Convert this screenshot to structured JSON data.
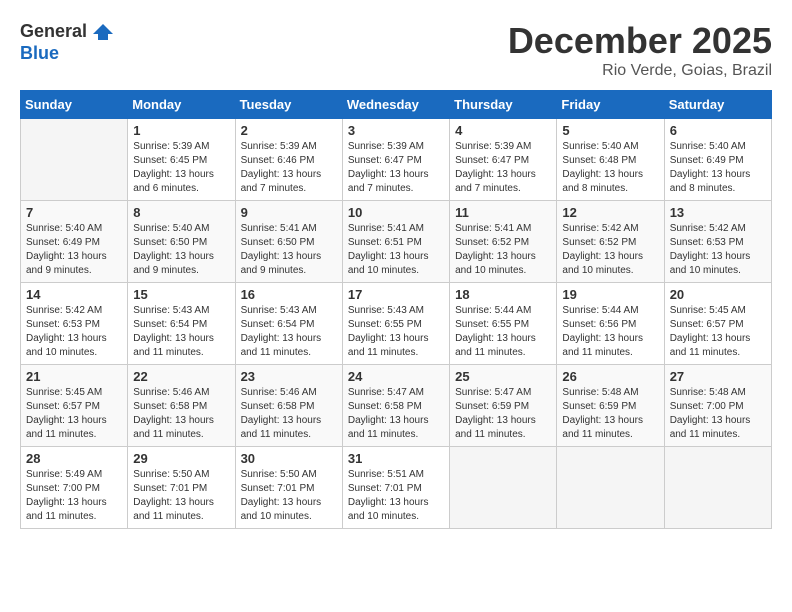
{
  "logo": {
    "general": "General",
    "blue": "Blue"
  },
  "title": "December 2025",
  "location": "Rio Verde, Goias, Brazil",
  "days_of_week": [
    "Sunday",
    "Monday",
    "Tuesday",
    "Wednesday",
    "Thursday",
    "Friday",
    "Saturday"
  ],
  "weeks": [
    [
      {
        "day": "",
        "sunrise": "",
        "sunset": "",
        "daylight": ""
      },
      {
        "day": "1",
        "sunrise": "Sunrise: 5:39 AM",
        "sunset": "Sunset: 6:45 PM",
        "daylight": "Daylight: 13 hours and 6 minutes."
      },
      {
        "day": "2",
        "sunrise": "Sunrise: 5:39 AM",
        "sunset": "Sunset: 6:46 PM",
        "daylight": "Daylight: 13 hours and 7 minutes."
      },
      {
        "day": "3",
        "sunrise": "Sunrise: 5:39 AM",
        "sunset": "Sunset: 6:47 PM",
        "daylight": "Daylight: 13 hours and 7 minutes."
      },
      {
        "day": "4",
        "sunrise": "Sunrise: 5:39 AM",
        "sunset": "Sunset: 6:47 PM",
        "daylight": "Daylight: 13 hours and 7 minutes."
      },
      {
        "day": "5",
        "sunrise": "Sunrise: 5:40 AM",
        "sunset": "Sunset: 6:48 PM",
        "daylight": "Daylight: 13 hours and 8 minutes."
      },
      {
        "day": "6",
        "sunrise": "Sunrise: 5:40 AM",
        "sunset": "Sunset: 6:49 PM",
        "daylight": "Daylight: 13 hours and 8 minutes."
      }
    ],
    [
      {
        "day": "7",
        "sunrise": "Sunrise: 5:40 AM",
        "sunset": "Sunset: 6:49 PM",
        "daylight": "Daylight: 13 hours and 9 minutes."
      },
      {
        "day": "8",
        "sunrise": "Sunrise: 5:40 AM",
        "sunset": "Sunset: 6:50 PM",
        "daylight": "Daylight: 13 hours and 9 minutes."
      },
      {
        "day": "9",
        "sunrise": "Sunrise: 5:41 AM",
        "sunset": "Sunset: 6:50 PM",
        "daylight": "Daylight: 13 hours and 9 minutes."
      },
      {
        "day": "10",
        "sunrise": "Sunrise: 5:41 AM",
        "sunset": "Sunset: 6:51 PM",
        "daylight": "Daylight: 13 hours and 10 minutes."
      },
      {
        "day": "11",
        "sunrise": "Sunrise: 5:41 AM",
        "sunset": "Sunset: 6:52 PM",
        "daylight": "Daylight: 13 hours and 10 minutes."
      },
      {
        "day": "12",
        "sunrise": "Sunrise: 5:42 AM",
        "sunset": "Sunset: 6:52 PM",
        "daylight": "Daylight: 13 hours and 10 minutes."
      },
      {
        "day": "13",
        "sunrise": "Sunrise: 5:42 AM",
        "sunset": "Sunset: 6:53 PM",
        "daylight": "Daylight: 13 hours and 10 minutes."
      }
    ],
    [
      {
        "day": "14",
        "sunrise": "Sunrise: 5:42 AM",
        "sunset": "Sunset: 6:53 PM",
        "daylight": "Daylight: 13 hours and 10 minutes."
      },
      {
        "day": "15",
        "sunrise": "Sunrise: 5:43 AM",
        "sunset": "Sunset: 6:54 PM",
        "daylight": "Daylight: 13 hours and 11 minutes."
      },
      {
        "day": "16",
        "sunrise": "Sunrise: 5:43 AM",
        "sunset": "Sunset: 6:54 PM",
        "daylight": "Daylight: 13 hours and 11 minutes."
      },
      {
        "day": "17",
        "sunrise": "Sunrise: 5:43 AM",
        "sunset": "Sunset: 6:55 PM",
        "daylight": "Daylight: 13 hours and 11 minutes."
      },
      {
        "day": "18",
        "sunrise": "Sunrise: 5:44 AM",
        "sunset": "Sunset: 6:55 PM",
        "daylight": "Daylight: 13 hours and 11 minutes."
      },
      {
        "day": "19",
        "sunrise": "Sunrise: 5:44 AM",
        "sunset": "Sunset: 6:56 PM",
        "daylight": "Daylight: 13 hours and 11 minutes."
      },
      {
        "day": "20",
        "sunrise": "Sunrise: 5:45 AM",
        "sunset": "Sunset: 6:57 PM",
        "daylight": "Daylight: 13 hours and 11 minutes."
      }
    ],
    [
      {
        "day": "21",
        "sunrise": "Sunrise: 5:45 AM",
        "sunset": "Sunset: 6:57 PM",
        "daylight": "Daylight: 13 hours and 11 minutes."
      },
      {
        "day": "22",
        "sunrise": "Sunrise: 5:46 AM",
        "sunset": "Sunset: 6:58 PM",
        "daylight": "Daylight: 13 hours and 11 minutes."
      },
      {
        "day": "23",
        "sunrise": "Sunrise: 5:46 AM",
        "sunset": "Sunset: 6:58 PM",
        "daylight": "Daylight: 13 hours and 11 minutes."
      },
      {
        "day": "24",
        "sunrise": "Sunrise: 5:47 AM",
        "sunset": "Sunset: 6:58 PM",
        "daylight": "Daylight: 13 hours and 11 minutes."
      },
      {
        "day": "25",
        "sunrise": "Sunrise: 5:47 AM",
        "sunset": "Sunset: 6:59 PM",
        "daylight": "Daylight: 13 hours and 11 minutes."
      },
      {
        "day": "26",
        "sunrise": "Sunrise: 5:48 AM",
        "sunset": "Sunset: 6:59 PM",
        "daylight": "Daylight: 13 hours and 11 minutes."
      },
      {
        "day": "27",
        "sunrise": "Sunrise: 5:48 AM",
        "sunset": "Sunset: 7:00 PM",
        "daylight": "Daylight: 13 hours and 11 minutes."
      }
    ],
    [
      {
        "day": "28",
        "sunrise": "Sunrise: 5:49 AM",
        "sunset": "Sunset: 7:00 PM",
        "daylight": "Daylight: 13 hours and 11 minutes."
      },
      {
        "day": "29",
        "sunrise": "Sunrise: 5:50 AM",
        "sunset": "Sunset: 7:01 PM",
        "daylight": "Daylight: 13 hours and 11 minutes."
      },
      {
        "day": "30",
        "sunrise": "Sunrise: 5:50 AM",
        "sunset": "Sunset: 7:01 PM",
        "daylight": "Daylight: 13 hours and 10 minutes."
      },
      {
        "day": "31",
        "sunrise": "Sunrise: 5:51 AM",
        "sunset": "Sunset: 7:01 PM",
        "daylight": "Daylight: 13 hours and 10 minutes."
      },
      {
        "day": "",
        "sunrise": "",
        "sunset": "",
        "daylight": ""
      },
      {
        "day": "",
        "sunrise": "",
        "sunset": "",
        "daylight": ""
      },
      {
        "day": "",
        "sunrise": "",
        "sunset": "",
        "daylight": ""
      }
    ]
  ]
}
